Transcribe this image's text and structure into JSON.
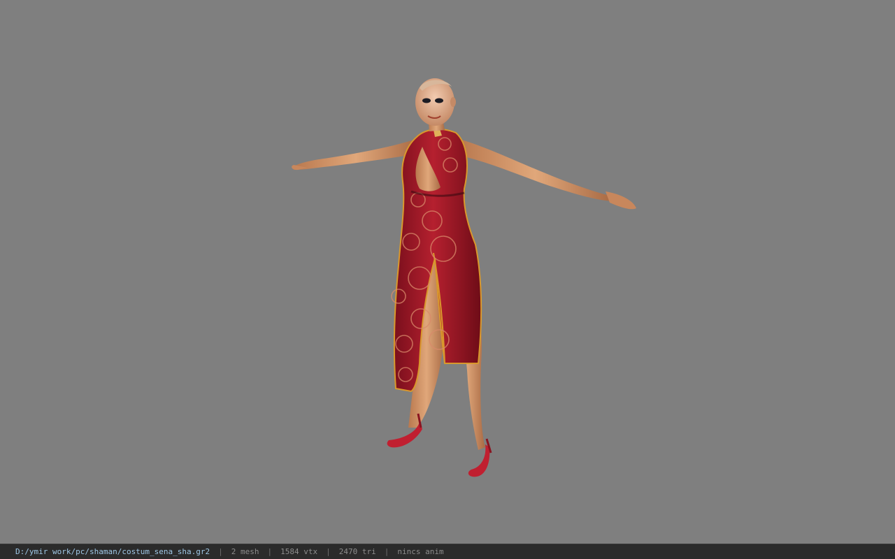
{
  "viewport": {
    "background": "#7f7f7f",
    "model_icon": "character-model-icon"
  },
  "status": {
    "file_path": "D:/ymir work/pc/shaman/costum_sena_sha.gr2",
    "separator": "|",
    "mesh": "2 mesh",
    "vertices": "1584 vtx",
    "triangles": "2470 tri",
    "animation": "nincs anim"
  },
  "colors": {
    "status_bg": "#2b2b2b",
    "path_text": "#9fc7e6",
    "info_text": "#8c8c8c",
    "dress_red": "#a8192a",
    "skin": "#d79a6e",
    "trim_gold": "#d9982c"
  }
}
